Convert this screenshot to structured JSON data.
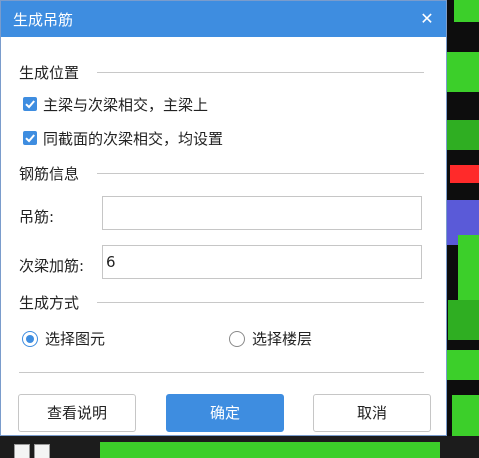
{
  "dialog": {
    "title": "生成吊筋",
    "close_glyph": "✕",
    "title_bar_color": "#3e8de0"
  },
  "position_section": {
    "title": "生成位置",
    "options": [
      {
        "label": "主梁与次梁相交，主梁上",
        "checked": true
      },
      {
        "label": "同截面的次梁相交，均设置",
        "checked": true
      }
    ]
  },
  "rebar_section": {
    "title": "钢筋信息",
    "hanger_label": "吊筋:",
    "hanger_value": "",
    "secondary_label": "次梁加筋:",
    "secondary_value": "6"
  },
  "method_section": {
    "title": "生成方式",
    "options": [
      {
        "label": "选择图元",
        "selected": true
      },
      {
        "label": "选择楼层",
        "selected": false
      }
    ]
  },
  "buttons": {
    "help": "查看说明",
    "ok": "确定",
    "cancel": "取消"
  }
}
